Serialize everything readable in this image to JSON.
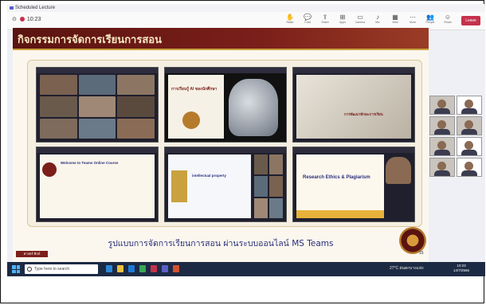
{
  "window": {
    "title": "Scheduled Lecture"
  },
  "toolbar": {
    "timer": "10:23",
    "buttons": [
      {
        "label": "Raise"
      },
      {
        "label": "Chat"
      },
      {
        "label": "Share"
      },
      {
        "label": "Apps"
      },
      {
        "label": "Camera"
      },
      {
        "label": "Mic"
      },
      {
        "label": "View"
      },
      {
        "label": "More"
      },
      {
        "label": "People"
      },
      {
        "label": "React"
      }
    ],
    "leave_label": "Leave"
  },
  "slide": {
    "title": "กิจกรรมการจัดการเรียนการสอน",
    "caption": "รูปแบบการจัดการเรียนการสอน ผ่านระบบออนไลน์ MS Teams",
    "page_number": "15",
    "brand": "ศาสตร์ ศิลป์",
    "screens": [
      {
        "text": ""
      },
      {
        "text": "การเรียนรู้ AI ของนักศึกษา"
      },
      {
        "text": "การพัฒนาทักษะการเรียน"
      },
      {
        "text": "Welcome to Teams Online Course"
      },
      {
        "text": "intellectual property"
      },
      {
        "text": "Research Ethics & Plagiarism"
      }
    ]
  },
  "taskbar": {
    "search_placeholder": "Type here to search",
    "weather": "27°C ฝนตกบางแห่ง",
    "time": "10:23",
    "date": "14/7/2566"
  },
  "colors": {
    "slide_header": "#7b1f1a",
    "gold": "#c9a13e",
    "caption": "#2a2f7a",
    "leave": "#c4314b",
    "taskbar": "#1d2a44"
  }
}
